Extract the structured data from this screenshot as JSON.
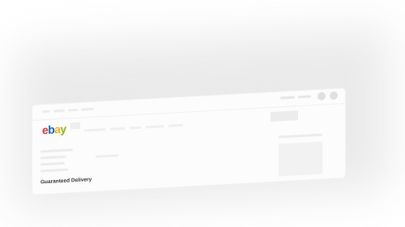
{
  "window": {
    "logo": {
      "e": "e",
      "b": "b",
      "a": "a",
      "y": "y"
    },
    "section_heading": "Guaranteed Delivery"
  },
  "colors": {
    "logo_e": "#e53238",
    "logo_b": "#0064d2",
    "logo_a": "#f5af02",
    "logo_y": "#86b817"
  },
  "icons": [
    "window-control-icon",
    "window-control-icon"
  ]
}
